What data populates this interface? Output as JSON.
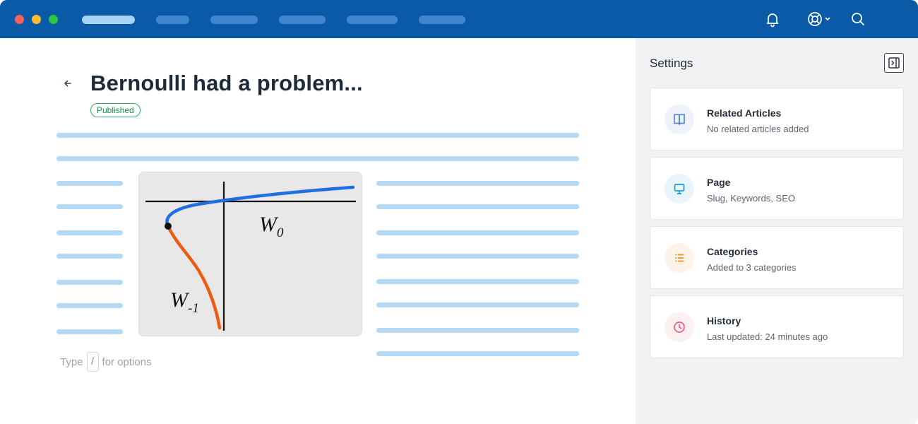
{
  "topbar": {
    "nav_items": [
      "",
      "",
      "",
      "",
      "",
      ""
    ],
    "icons": [
      "bell-icon",
      "lifebuoy-icon",
      "chevron-down-icon",
      "search-icon"
    ]
  },
  "editor": {
    "title": "Bernoulli had a problem...",
    "status_badge": "Published",
    "hint_prefix": "Type",
    "hint_key": "/",
    "hint_suffix": "for options",
    "figure": {
      "label_w0": "W",
      "label_w0_sub": "0",
      "label_w1": "W",
      "label_w1_sub": "-1"
    }
  },
  "sidebar": {
    "title": "Settings",
    "cards": [
      {
        "title": "Related Articles",
        "subtitle": "No related articles added",
        "icon": "book-icon",
        "color": "#4a7fd6"
      },
      {
        "title": "Page",
        "subtitle": "Slug, Keywords, SEO",
        "icon": "monitor-icon",
        "color": "#1a9ad6"
      },
      {
        "title": "Categories",
        "subtitle": "Added to 3 categories",
        "icon": "list-icon",
        "color": "#f08a24"
      },
      {
        "title": "History",
        "subtitle": "Last updated: 24 minutes ago",
        "icon": "clock-icon",
        "color": "#ee5a7a"
      }
    ]
  },
  "colors": {
    "topbar": "#0a5aa8",
    "accent_blue_curve": "#1f6fe0",
    "accent_orange_curve": "#ee5a12",
    "published_green": "#2fae63"
  }
}
